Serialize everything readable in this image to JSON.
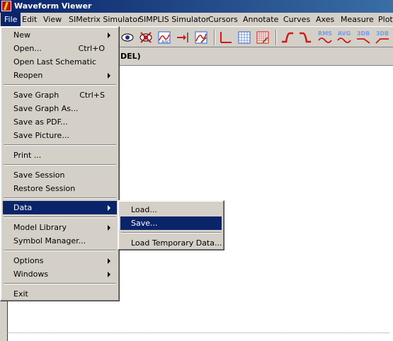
{
  "window": {
    "title": "Waveform Viewer"
  },
  "menubar": {
    "items": [
      "File",
      "Edit",
      "View",
      "SIMetrix Simulator",
      "SIMPLIS Simulator",
      "Cursors",
      "Annotate",
      "Curves",
      "Axes",
      "Measure",
      "Plot"
    ]
  },
  "toolbar": {
    "rms_label": "RMS",
    "avg_label": "AVG",
    "db_label": "3DB",
    "db2_label": "3DB"
  },
  "graph": {
    "tab_title_fragment": "DEL)"
  },
  "file_menu": {
    "items": [
      {
        "label": "New",
        "shortcut": "",
        "submenu": true
      },
      {
        "label": "Open...",
        "shortcut": "Ctrl+O",
        "submenu": false
      },
      {
        "label": "Open Last Schematic",
        "shortcut": "",
        "submenu": false
      },
      {
        "label": "Reopen",
        "shortcut": "",
        "submenu": true
      },
      {
        "label": "Save Graph",
        "shortcut": "Ctrl+S",
        "submenu": false
      },
      {
        "label": "Save Graph As...",
        "shortcut": "",
        "submenu": false
      },
      {
        "label": "Save as PDF...",
        "shortcut": "",
        "submenu": false
      },
      {
        "label": "Save Picture...",
        "shortcut": "",
        "submenu": false
      },
      {
        "label": "Print ...",
        "shortcut": "",
        "submenu": false
      },
      {
        "label": "Save Session",
        "shortcut": "",
        "submenu": false
      },
      {
        "label": "Restore Session",
        "shortcut": "",
        "submenu": false
      },
      {
        "label": "Data",
        "shortcut": "",
        "submenu": true,
        "highlighted": true
      },
      {
        "label": "Model Library",
        "shortcut": "",
        "submenu": true
      },
      {
        "label": "Symbol Manager...",
        "shortcut": "",
        "submenu": false
      },
      {
        "label": "Options",
        "shortcut": "",
        "submenu": true
      },
      {
        "label": "Windows",
        "shortcut": "",
        "submenu": true
      },
      {
        "label": "Exit",
        "shortcut": "",
        "submenu": false
      }
    ]
  },
  "data_submenu": {
    "items": [
      {
        "label": "Load...",
        "highlighted": false
      },
      {
        "label": "Save...",
        "highlighted": true
      },
      {
        "label": "Load Temporary Data...",
        "highlighted": false
      }
    ]
  },
  "colors": {
    "highlight": "#0a246a",
    "menu_bg": "#d4d0c8",
    "title_gradient_end": "#3a6ea5",
    "waveform_red": "#d01818",
    "graph_blue": "#3060d0"
  }
}
